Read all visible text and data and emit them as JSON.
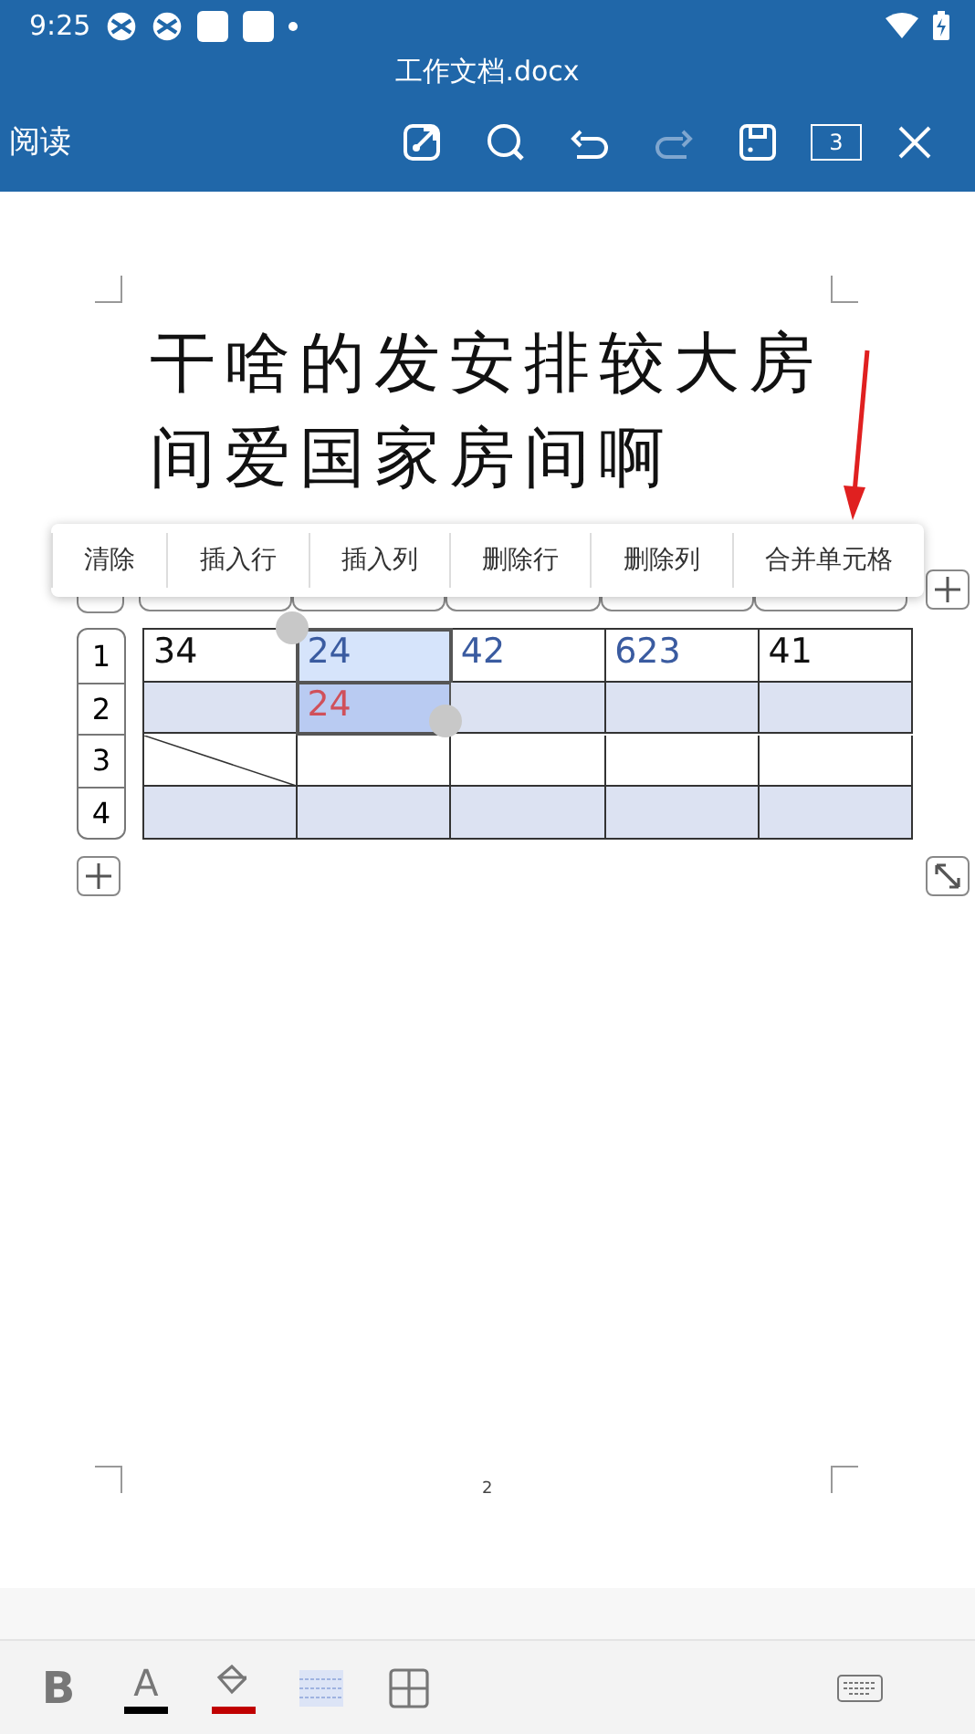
{
  "status_bar": {
    "time": "9:25"
  },
  "title_bar": {
    "title": "工作文档.docx",
    "mode": "阅读",
    "page_count": "3",
    "redo_disabled": true
  },
  "document": {
    "heading": "干啥的发安排较大房间爱国家房间啊",
    "page_number": "2",
    "context_menu": [
      "清除",
      "插入行",
      "插入列",
      "删除行",
      "删除列",
      "合并单元格"
    ],
    "table": {
      "rows": [
        {
          "number": "1",
          "shaded": false,
          "cells": [
            {
              "text": "34",
              "color": "#111111",
              "selected": false
            },
            {
              "text": "24",
              "color": "#3a5ba0",
              "selected": true
            },
            {
              "text": "42",
              "color": "#3a5ba0",
              "selected": false
            },
            {
              "text": "623",
              "color": "#3a5ba0",
              "selected": false
            },
            {
              "text": "41",
              "color": "#111111",
              "selected": false
            }
          ]
        },
        {
          "number": "2",
          "shaded": true,
          "cells": [
            {
              "selected": false
            },
            {
              "text": "24",
              "color": "#d0505a",
              "selected": true
            },
            {
              "selected": false
            },
            {
              "selected": false
            },
            {
              "selected": false
            }
          ]
        },
        {
          "number": "3",
          "shaded": false,
          "cells": [
            {
              "selected": false,
              "diagonal": true
            },
            {
              "selected": false
            },
            {
              "selected": false
            },
            {
              "selected": false
            },
            {
              "selected": false
            }
          ]
        },
        {
          "number": "4",
          "shaded": true,
          "cells": [
            {
              "selected": false
            },
            {
              "selected": false
            },
            {
              "selected": false
            },
            {
              "selected": false
            },
            {
              "selected": false
            }
          ]
        }
      ]
    }
  },
  "bottom_toolbar": [
    {
      "kind": "bold",
      "label": "B"
    },
    {
      "kind": "font_color",
      "label": "A",
      "color": "#000000"
    },
    {
      "kind": "fill_color",
      "color": "#c00000"
    },
    {
      "kind": "shading"
    },
    {
      "kind": "table"
    },
    {
      "kind": "keyboard"
    }
  ]
}
